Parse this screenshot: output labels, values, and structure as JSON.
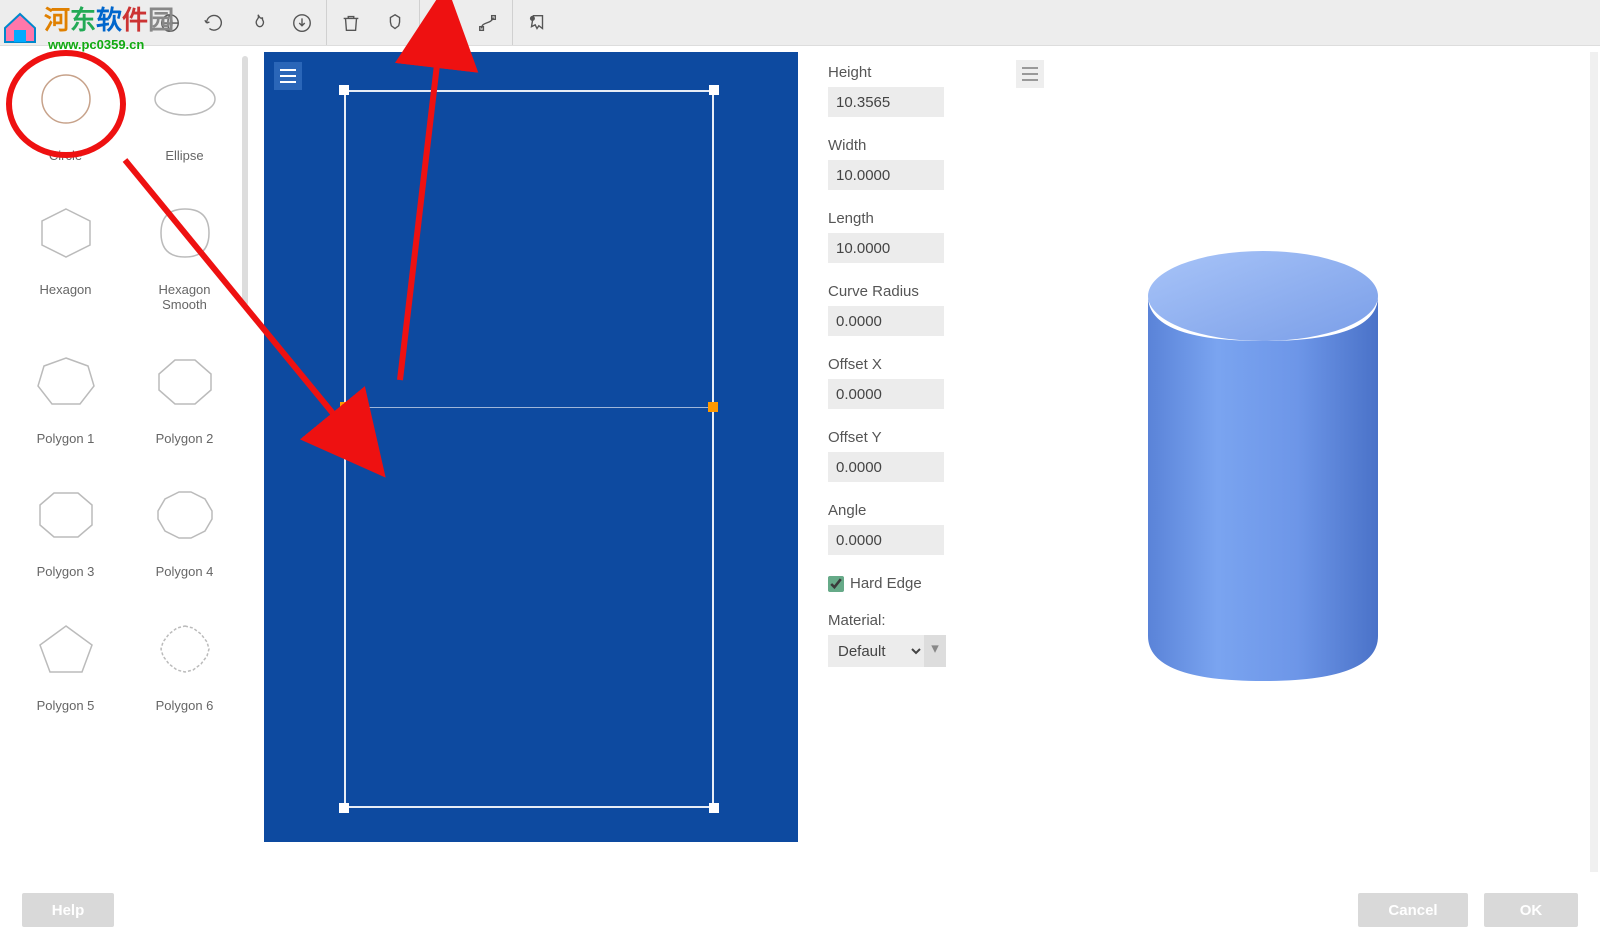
{
  "watermark": {
    "text_main": "河东软件园",
    "url": "www.pc0359.cn"
  },
  "toolbar": {
    "icons": [
      "home",
      "layers",
      "pick",
      "globe",
      "reload",
      "fire",
      "trash",
      "shape",
      "path",
      "curve",
      "export"
    ]
  },
  "shapes": [
    {
      "label": "Circle",
      "type": "circle"
    },
    {
      "label": "Ellipse",
      "type": "ellipse"
    },
    {
      "label": "Hexagon",
      "type": "hex"
    },
    {
      "label": "Hexagon\nSmooth",
      "type": "hex-smooth"
    },
    {
      "label": "Polygon 1",
      "type": "poly1"
    },
    {
      "label": "Polygon 2",
      "type": "poly2"
    },
    {
      "label": "Polygon 3",
      "type": "poly3"
    },
    {
      "label": "Polygon 4",
      "type": "poly4"
    },
    {
      "label": "Polygon 5",
      "type": "poly5"
    },
    {
      "label": "Polygon 6",
      "type": "poly6"
    }
  ],
  "props": {
    "height_label": "Height",
    "height": "10.3565",
    "width_label": "Width",
    "width": "10.0000",
    "length_label": "Length",
    "length": "10.0000",
    "curve_label": "Curve Radius",
    "curve": "0.0000",
    "ox_label": "Offset X",
    "ox": "0.0000",
    "oy_label": "Offset Y",
    "oy": "0.0000",
    "angle_label": "Angle",
    "angle": "0.0000",
    "hard_edge_label": "Hard Edge",
    "hard_edge": true,
    "material_label": "Material:",
    "material": "Default"
  },
  "buttons": {
    "help": "Help",
    "cancel": "Cancel",
    "ok": "OK"
  }
}
